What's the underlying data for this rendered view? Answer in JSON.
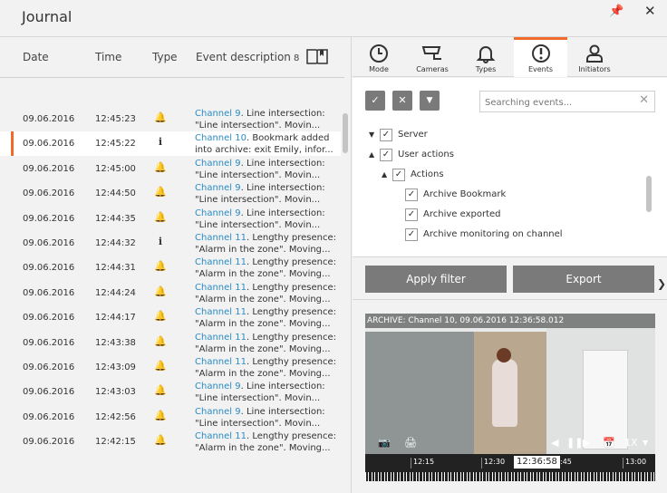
{
  "window": {
    "title": "Journal"
  },
  "table": {
    "headers": {
      "date": "Date",
      "time": "Time",
      "type": "Type",
      "description": "Event description"
    },
    "event_count": "8",
    "rows": [
      {
        "date": "09.06.2016",
        "time": "12:45:23",
        "type": "bell",
        "channel": "Channel 9",
        "desc1": ". Line intersection:",
        "desc2": "\"Line intersection\". Movin...",
        "selected": false
      },
      {
        "date": "09.06.2016",
        "time": "12:45:22",
        "type": "info",
        "channel": "Channel 10",
        "desc1": ". Bookmark added",
        "desc2": "into archive: exit Emily, infor...",
        "selected": true
      },
      {
        "date": "09.06.2016",
        "time": "12:45:00",
        "type": "bell",
        "channel": "Channel 9",
        "desc1": ". Line intersection:",
        "desc2": "\"Line intersection\". Movin...",
        "selected": false
      },
      {
        "date": "09.06.2016",
        "time": "12:44:50",
        "type": "bell",
        "channel": "Channel 9",
        "desc1": ". Line intersection:",
        "desc2": "\"Line intersection\". Movin...",
        "selected": false
      },
      {
        "date": "09.06.2016",
        "time": "12:44:35",
        "type": "bell",
        "channel": "Channel 9",
        "desc1": ". Line intersection:",
        "desc2": "\"Line intersection\". Movin...",
        "selected": false
      },
      {
        "date": "09.06.2016",
        "time": "12:44:32",
        "type": "info",
        "channel": "Channel 11",
        "desc1": ". Lengthy presence:",
        "desc2": "\"Alarm in the zone\". Moving...",
        "selected": false
      },
      {
        "date": "09.06.2016",
        "time": "12:44:31",
        "type": "bell",
        "channel": "Channel 11",
        "desc1": ". Lengthy presence:",
        "desc2": "\"Alarm in the zone\". Moving...",
        "selected": false
      },
      {
        "date": "09.06.2016",
        "time": "12:44:24",
        "type": "bell",
        "channel": "Channel 11",
        "desc1": ". Lengthy presence:",
        "desc2": "\"Alarm in the zone\". Moving...",
        "selected": false
      },
      {
        "date": "09.06.2016",
        "time": "12:44:17",
        "type": "bell",
        "channel": "Channel 11",
        "desc1": ". Lengthy presence:",
        "desc2": "\"Alarm in the zone\". Moving...",
        "selected": false
      },
      {
        "date": "09.06.2016",
        "time": "12:43:38",
        "type": "bell",
        "channel": "Channel 11",
        "desc1": ". Lengthy presence:",
        "desc2": "\"Alarm in the zone\". Moving...",
        "selected": false
      },
      {
        "date": "09.06.2016",
        "time": "12:43:09",
        "type": "bell",
        "channel": "Channel 11",
        "desc1": ". Lengthy presence:",
        "desc2": "\"Alarm in the zone\". Moving...",
        "selected": false
      },
      {
        "date": "09.06.2016",
        "time": "12:43:03",
        "type": "bell",
        "channel": "Channel 9",
        "desc1": ". Line intersection:",
        "desc2": "\"Line intersection\". Movin...",
        "selected": false
      },
      {
        "date": "09.06.2016",
        "time": "12:42:56",
        "type": "bell",
        "channel": "Channel 9",
        "desc1": ". Line intersection:",
        "desc2": "\"Line intersection\". Movin...",
        "selected": false
      },
      {
        "date": "09.06.2016",
        "time": "12:42:15",
        "type": "bell",
        "channel": "Channel 11",
        "desc1": ". Lengthy presence:",
        "desc2": "\"Alarm in the zone\". Moving...",
        "selected": false
      }
    ]
  },
  "tabs": [
    {
      "label": "Mode",
      "icon": "clock-icon",
      "active": false
    },
    {
      "label": "Cameras",
      "icon": "camera-icon",
      "active": false
    },
    {
      "label": "Types",
      "icon": "bell-icon",
      "active": false
    },
    {
      "label": "Events",
      "icon": "alert-circle-icon",
      "active": true
    },
    {
      "label": "Initiators",
      "icon": "user-icon",
      "active": false
    }
  ],
  "filter": {
    "search_placeholder": "Searching events...",
    "tree": [
      {
        "label": "Server",
        "checked": true,
        "level": 0,
        "arrow": "down"
      },
      {
        "label": "User actions",
        "checked": true,
        "level": 0,
        "arrow": "up"
      },
      {
        "label": "Actions",
        "checked": true,
        "level": 1,
        "arrow": "up"
      },
      {
        "label": "Archive Bookmark",
        "checked": true,
        "level": 2,
        "arrow": ""
      },
      {
        "label": "Archive exported",
        "checked": true,
        "level": 2,
        "arrow": ""
      },
      {
        "label": "Archive monitoring on channel",
        "checked": true,
        "level": 2,
        "arrow": ""
      }
    ]
  },
  "buttons": {
    "apply": "Apply filter",
    "export": "Export"
  },
  "video": {
    "caption": "ARCHIVE: Channel 10, 09.06.2016 12:36:58.012",
    "speed": "1X",
    "current_time": "12:36:58",
    "ticks": [
      "12:15",
      "12:30",
      ":45",
      "13:00"
    ]
  },
  "colors": {
    "accent": "#f06a2b",
    "link": "#2a8cc4",
    "button": "#7a7a7a"
  }
}
